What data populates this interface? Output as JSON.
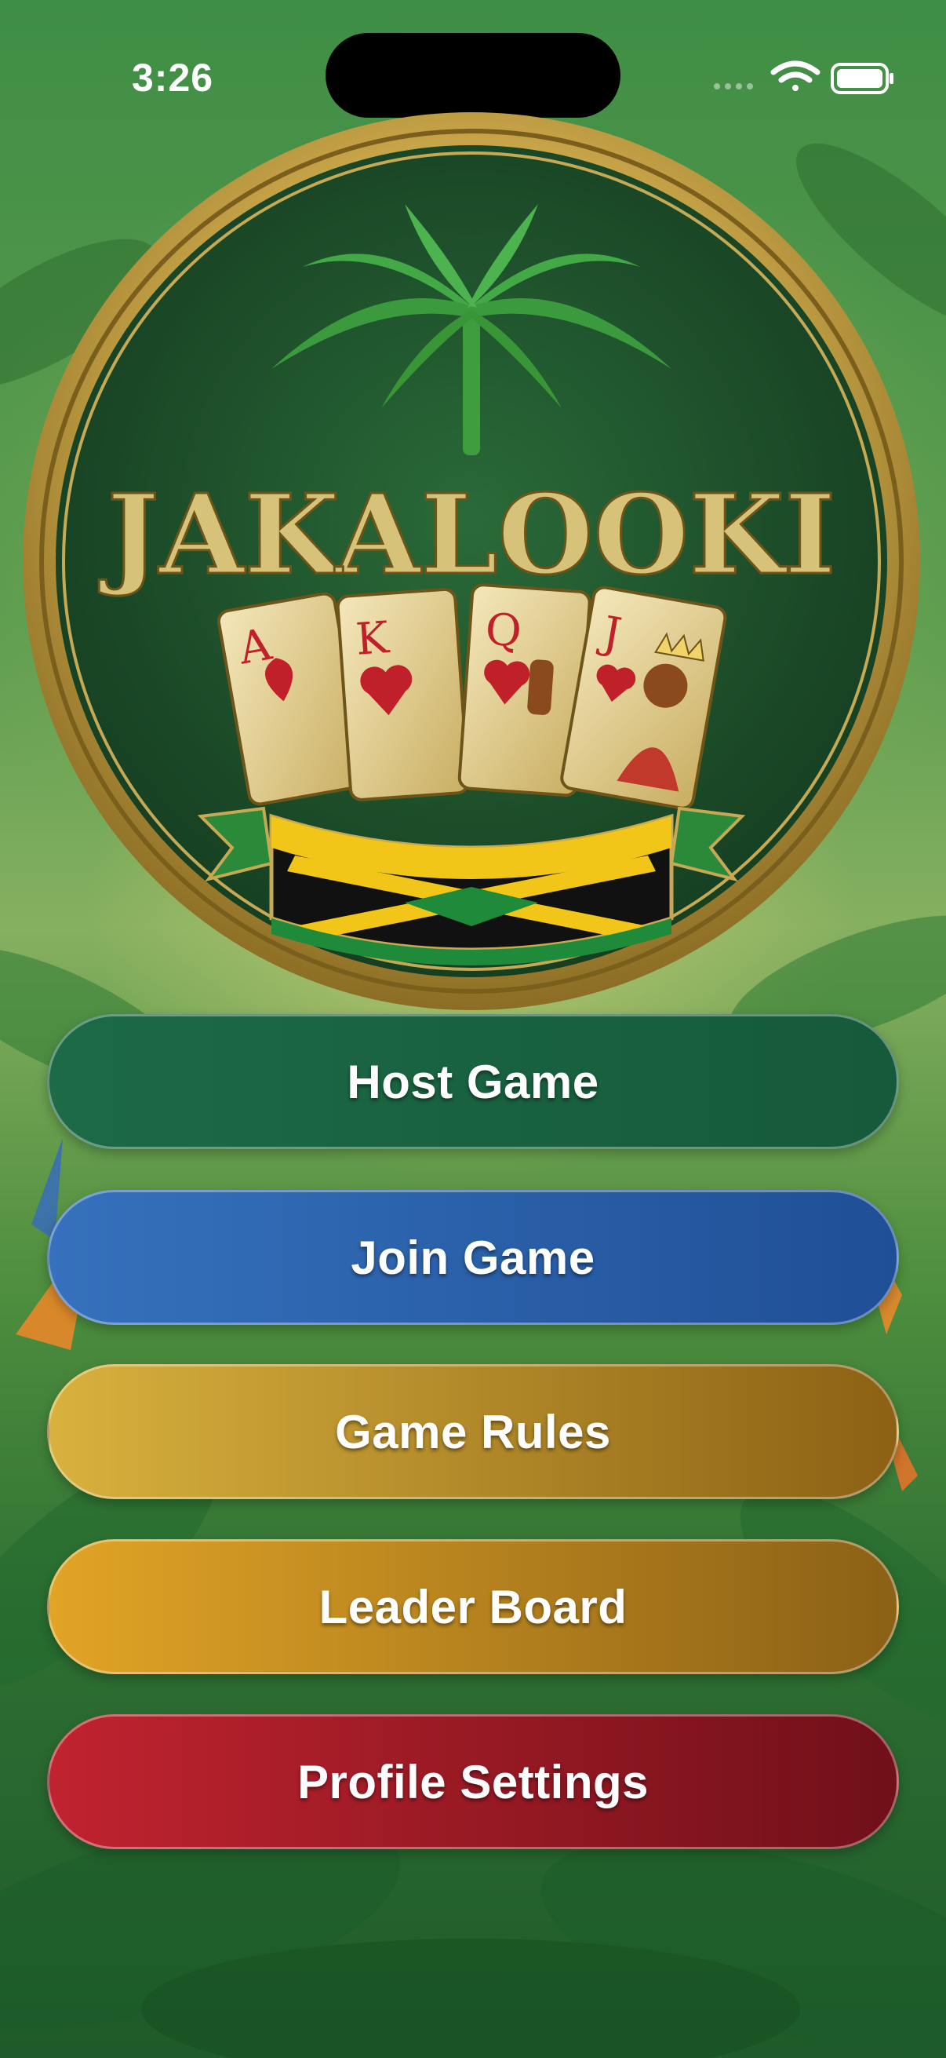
{
  "status_bar": {
    "time": "3:26",
    "icons": [
      "signal-dots-icon",
      "wifi-icon",
      "battery-icon"
    ]
  },
  "emblem": {
    "title": "JAKALOOKI",
    "cards": [
      "A",
      "K",
      "Q",
      "J"
    ],
    "colors": {
      "gold": "#c9b56a",
      "green": "#1f5a2f",
      "flag_yellow": "#f2c618",
      "flag_green": "#1f8a3a",
      "flag_black": "#111111"
    }
  },
  "menu": {
    "host_game": "Host Game",
    "join_game": "Join Game",
    "game_rules": "Game Rules",
    "leader_board": "Leader Board",
    "profile_settings": "Profile Settings"
  },
  "colors": {
    "host": "#1d6a46",
    "join": "#3671bd",
    "rules": "#d8b13e",
    "leader": "#e1a426",
    "profile": "#c0232f"
  }
}
